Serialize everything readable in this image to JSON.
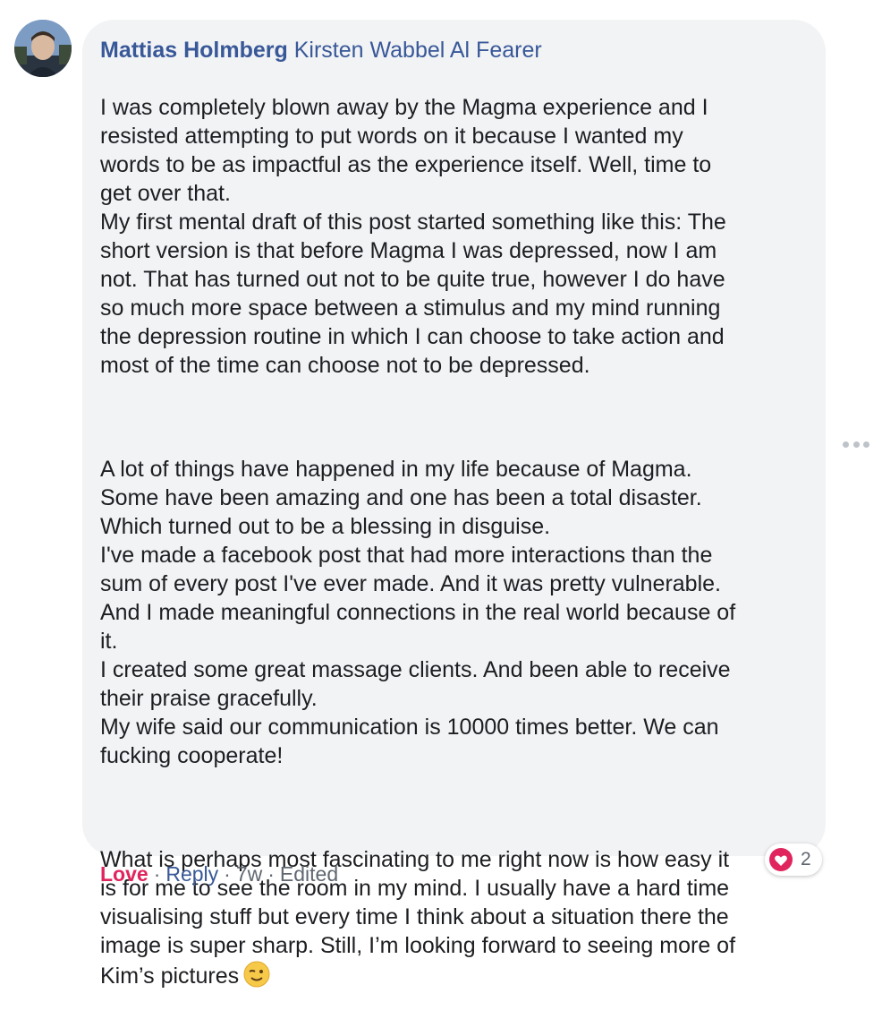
{
  "comment": {
    "author": "Mattias Holmberg",
    "tagged": "Kirsten Wabbel Al Fearer",
    "paragraphs": [
      "I was completely blown away by the Magma experience and I\nresisted attempting to put words on it because I wanted my\nwords to be as impactful as the experience itself. Well, time to\nget over that.\nMy first mental draft of this post started something like this: The\nshort version is that before Magma I was depressed, now I am\nnot. That has turned out not to be quite true, however I do have\nso much more space between a stimulus and my mind running\nthe depression routine in which I can choose to take action and\nmost of the time can choose not to be depressed.",
      "A lot of things have happened in my life because of Magma.\nSome have been amazing and one has been a total disaster.\nWhich turned out to be a blessing in disguise.\nI've made a facebook post that had more interactions than the\nsum of every post I've ever made. And it was pretty vulnerable.\nAnd I made meaningful connections in the real world because of\nit.\nI created some great massage clients. And been able to receive\ntheir praise gracefully.\nMy wife said our communication is 10000 times better. We can\nfucking cooperate!",
      "What is perhaps most fascinating to me right now is how easy it\nis for me to see the room in my mind. I usually have a hard time\nvisualising stuff but every time I think about a situation there the\nimage is super sharp. Still, I’m looking forward to seeing more of\nKim’s pictures"
    ],
    "emoji": "winking-face-icon"
  },
  "reactions": {
    "icon": "heart-icon",
    "count": "2",
    "color": "#e0245e"
  },
  "footer": {
    "love_label": "Love",
    "reply_label": "Reply",
    "time": "7w",
    "edited": "Edited",
    "separator": "·"
  },
  "more_options_icon": "ellipsis-icon"
}
